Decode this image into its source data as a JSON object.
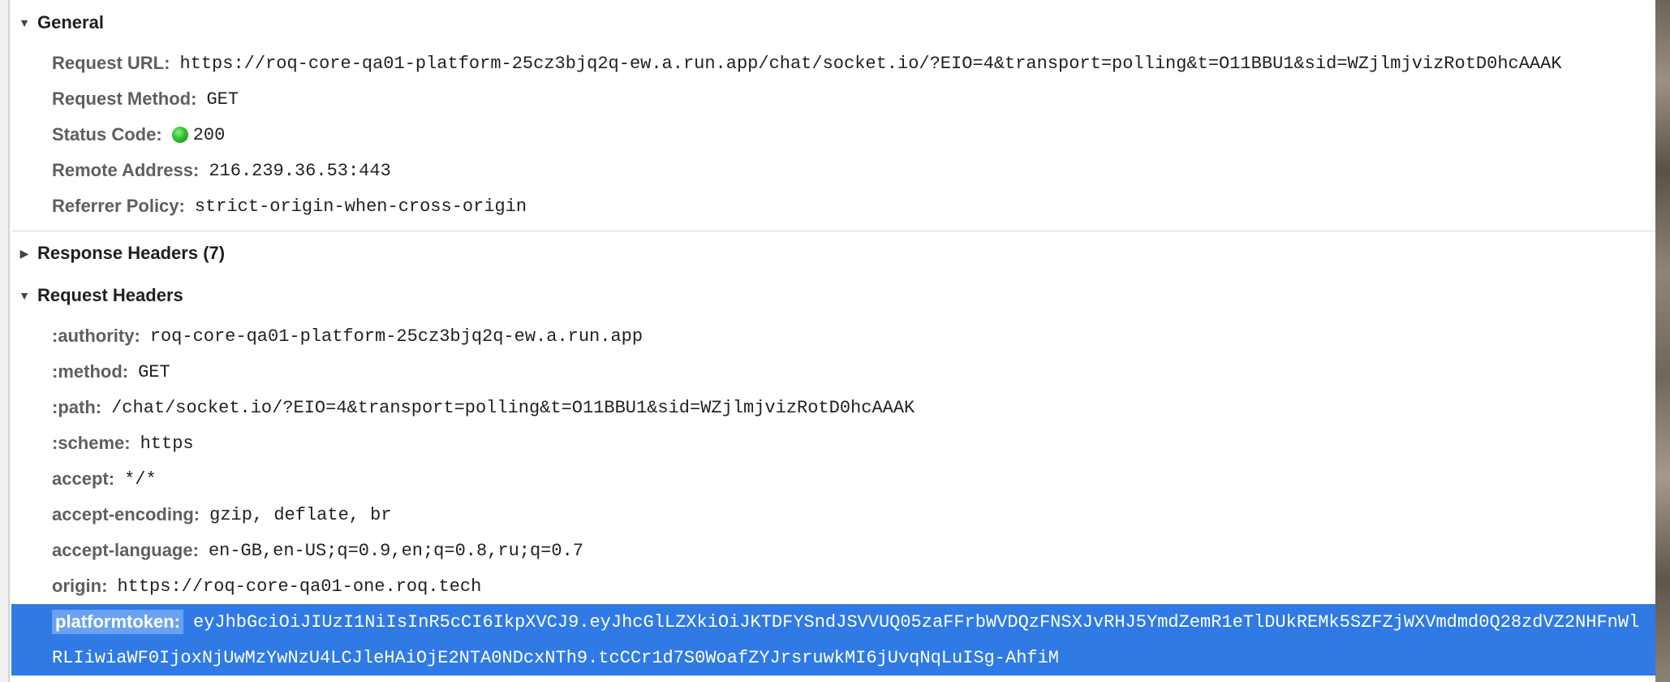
{
  "general": {
    "title": "General",
    "rows": [
      {
        "key": "Request URL:",
        "value": "https://roq-core-qa01-platform-25cz3bjq2q-ew.a.run.app/chat/socket.io/?EIO=4&transport=polling&t=O11BBU1&sid=WZjlmjvizRotD0hcAAAK"
      },
      {
        "key": "Request Method:",
        "value": "GET"
      },
      {
        "key": "Status Code:",
        "value": "200"
      },
      {
        "key": "Remote Address:",
        "value": "216.239.36.53:443"
      },
      {
        "key": "Referrer Policy:",
        "value": "strict-origin-when-cross-origin"
      }
    ]
  },
  "response_headers": {
    "title": "Response Headers (7)"
  },
  "request_headers": {
    "title": "Request Headers",
    "rows": [
      {
        "key": ":authority:",
        "value": "roq-core-qa01-platform-25cz3bjq2q-ew.a.run.app"
      },
      {
        "key": ":method:",
        "value": "GET"
      },
      {
        "key": ":path:",
        "value": "/chat/socket.io/?EIO=4&transport=polling&t=O11BBU1&sid=WZjlmjvizRotD0hcAAAK"
      },
      {
        "key": ":scheme:",
        "value": "https"
      },
      {
        "key": "accept:",
        "value": "*/*"
      },
      {
        "key": "accept-encoding:",
        "value": "gzip, deflate, br"
      },
      {
        "key": "accept-language:",
        "value": "en-GB,en-US;q=0.9,en;q=0.8,ru;q=0.7"
      },
      {
        "key": "origin:",
        "value": "https://roq-core-qa01-one.roq.tech"
      }
    ],
    "selected": {
      "key": "platformtoken:",
      "value_line1": "eyJhbGciOiJIUzI1NiIsInR5cCI6IkpXVCJ9.eyJhcGlLZXkiOiJKTDFYSndJSVVUQ05zaFFrbWVDQzFNSXJvRHJ5YmdZemR1eTlDUkREMk5SZFZjWXVmdmd0Q28zdVZ2NHFnWl",
      "value_line2": "RLIiwiaWF0IjoxNjUwMzYwNzU4LCJleHAiOjE2NTA0NDcxNTh9.tcCCr1d7S0WoafZYJrsruwkMI6jUvqNqLuISg-AhfiM"
    }
  },
  "colors": {
    "selection": "#2f7ae5",
    "status_ok": "#2fbf2f"
  }
}
